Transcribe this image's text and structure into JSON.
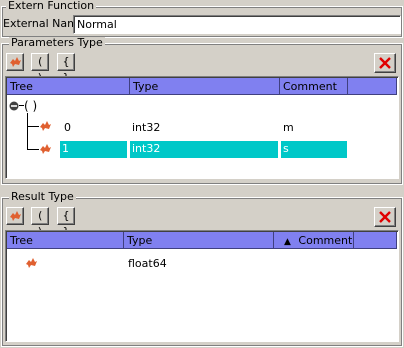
{
  "extern_function": {
    "legend": "Extern Function",
    "name_label": "External Name",
    "name_value": "Normal"
  },
  "parameters": {
    "legend": "Parameters Type",
    "toolbar": {
      "paren_label": "( )",
      "brace_label": "{ }"
    },
    "columns": {
      "tree": "Tree",
      "type": "Type",
      "comment": "Comment"
    },
    "root_label": "( )",
    "rows": [
      {
        "tree": "0",
        "type": "int32",
        "comment": "m",
        "selected": false
      },
      {
        "tree": "1",
        "type": "int32",
        "comment": "s",
        "selected": true
      }
    ]
  },
  "result": {
    "legend": "Result Type",
    "toolbar": {
      "paren_label": "( )",
      "brace_label": "{ }"
    },
    "columns": {
      "tree": "Tree",
      "type": "Type",
      "comment": "Comment",
      "sort_marker": "▲"
    },
    "rows": [
      {
        "tree": "",
        "type": "float64",
        "comment": ""
      }
    ]
  },
  "colors": {
    "header": "#8080f0",
    "selection": "#00c8c8",
    "node_icon": "#e06030",
    "delete": "#e00000"
  },
  "icons": {
    "node": "node-icon",
    "delete": "delete-x-icon",
    "collapse": "collapse-minus-icon"
  }
}
